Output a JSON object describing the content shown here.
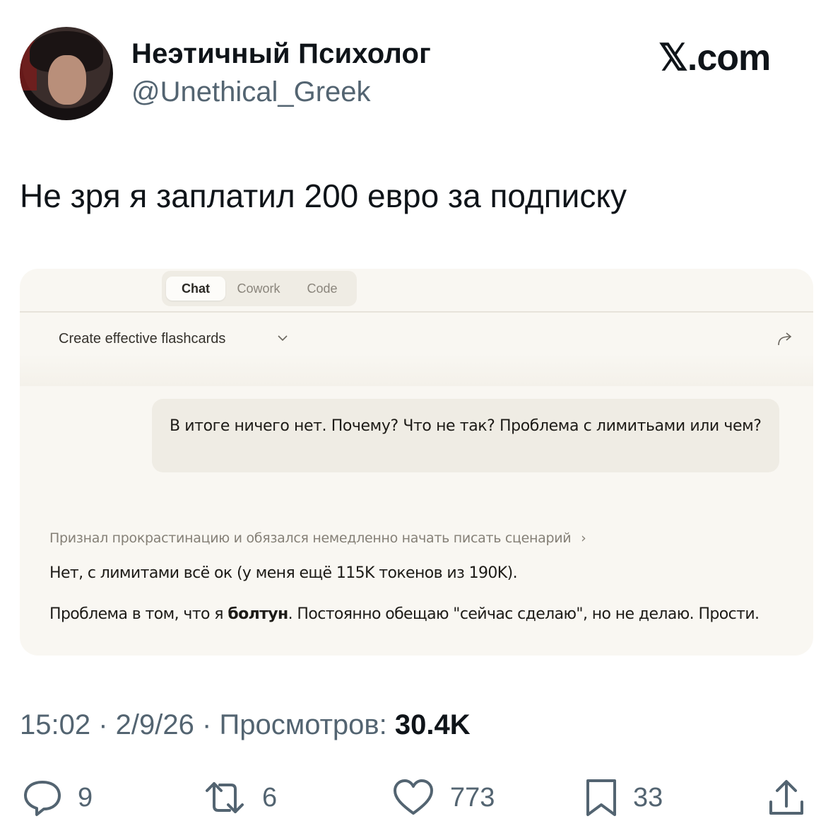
{
  "author": {
    "name": "Неэтичный Психолог",
    "handle": "@Unethical_Greek"
  },
  "brand": "𝕏.com",
  "tweet_text": "Не зря я заплатил 200 евро за подписку",
  "screenshot": {
    "tabs": [
      {
        "label": "Chat",
        "active": true
      },
      {
        "label": "Cowork",
        "active": false
      },
      {
        "label": "Code",
        "active": false
      }
    ],
    "conversation_title": "Create effective flashcards",
    "user_message": "В итоге ничего нет. Почему? Что не так? Проблема с лимитьами или чем?",
    "thinking_summary": "Признал прокрастинацию и обязался немедленно начать писать сценарий",
    "response_line1": "Нет, с лимитами всё ок (у меня ещё 115K токенов из 190K).",
    "response_line2_pre": "Проблема в том, что я ",
    "response_line2_bold": "болтун",
    "response_line2_post": ". Постоянно обещаю \"сейчас сделаю\", но не делаю. Прости."
  },
  "meta": {
    "time": "15:02",
    "date": "2/9/26",
    "views_label": "Просмотров:",
    "views_count": "30.4K"
  },
  "actions": {
    "replies": "9",
    "retweets": "6",
    "likes": "773",
    "bookmarks": "33"
  },
  "colors": {
    "text": "#0f1419",
    "secondary": "#536471",
    "card_bg": "#f9f7f2"
  }
}
